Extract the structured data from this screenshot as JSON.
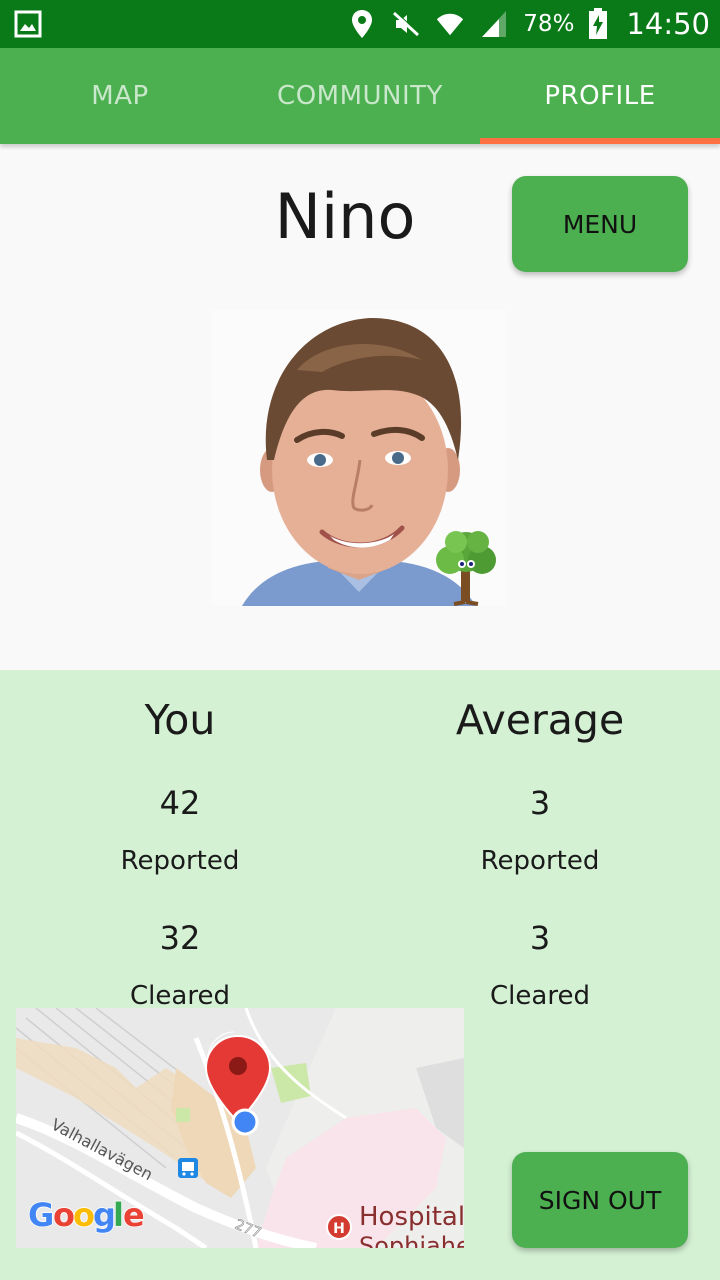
{
  "status_bar": {
    "battery": "78%",
    "time": "14:50",
    "icons": [
      "gallery-notification-icon",
      "location-icon",
      "mute-icon",
      "wifi-icon",
      "signal-icon",
      "battery-charging-icon"
    ]
  },
  "tabs": [
    {
      "label": "MAP",
      "active": false
    },
    {
      "label": "COMMUNITY",
      "active": false
    },
    {
      "label": "PROFILE",
      "active": true
    }
  ],
  "profile": {
    "name": "Nino",
    "menu_label": "MENU",
    "avatar_badge": "tree-badge-icon"
  },
  "stats": {
    "you": {
      "heading": "You",
      "reported": "42",
      "reported_label": "Reported",
      "cleared": "32",
      "cleared_label": "Cleared"
    },
    "average": {
      "heading": "Average",
      "reported": "3",
      "reported_label": "Reported",
      "cleared": "3",
      "cleared_label": "Cleared"
    }
  },
  "map": {
    "street_label": "Valhallavägen",
    "road_number": "277",
    "poi_label": "Hospital",
    "poi_sublabel": "Sophiahem",
    "logo": "Google"
  },
  "actions": {
    "sign_out_label": "SIGN OUT"
  },
  "colors": {
    "status_bar": "#0a7a18",
    "primary": "#4caf50",
    "tab_indicator": "#ff7043",
    "stats_bg": "#d4f1d4",
    "marker": "#e53935",
    "location_dot": "#4285f4"
  }
}
